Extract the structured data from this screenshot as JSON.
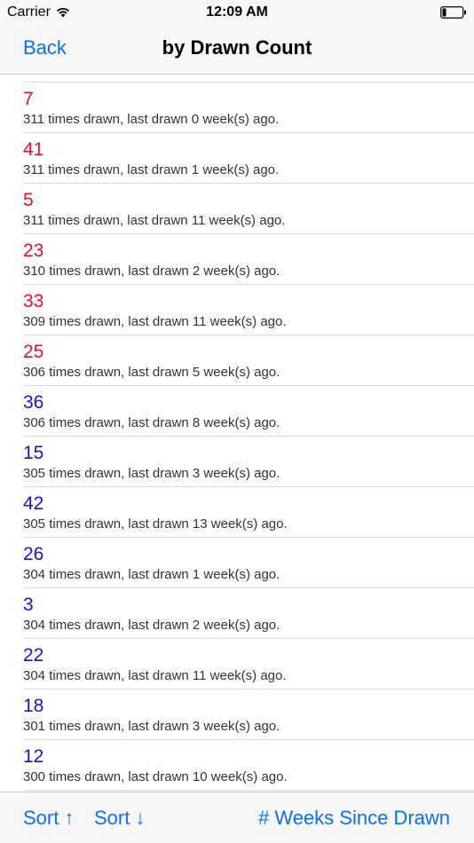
{
  "status_bar": {
    "carrier": "Carrier",
    "time": "12:09 AM"
  },
  "nav": {
    "back_label": "Back",
    "title": "by Drawn Count"
  },
  "colors": {
    "accent": "#0b6ffc",
    "hot": "#e8102a",
    "cold": "#1a12d6"
  },
  "rows": [
    {
      "number": "7",
      "detail": "311 times drawn, last drawn 0 week(s) ago.",
      "group": "hot"
    },
    {
      "number": "41",
      "detail": "311 times drawn, last drawn 1 week(s) ago.",
      "group": "hot"
    },
    {
      "number": "5",
      "detail": "311 times drawn, last drawn 11 week(s) ago.",
      "group": "hot"
    },
    {
      "number": "23",
      "detail": "310 times drawn, last drawn 2 week(s) ago.",
      "group": "hot"
    },
    {
      "number": "33",
      "detail": "309 times drawn, last drawn 11 week(s) ago.",
      "group": "hot"
    },
    {
      "number": "25",
      "detail": "306 times drawn, last drawn 5 week(s) ago.",
      "group": "hot"
    },
    {
      "number": "36",
      "detail": "306 times drawn, last drawn 8 week(s) ago.",
      "group": "cold"
    },
    {
      "number": "15",
      "detail": "305 times drawn, last drawn 3 week(s) ago.",
      "group": "cold"
    },
    {
      "number": "42",
      "detail": "305 times drawn, last drawn 13 week(s) ago.",
      "group": "cold"
    },
    {
      "number": "26",
      "detail": "304 times drawn, last drawn 1 week(s) ago.",
      "group": "cold"
    },
    {
      "number": "3",
      "detail": "304 times drawn, last drawn 2 week(s) ago.",
      "group": "cold"
    },
    {
      "number": "22",
      "detail": "304 times drawn, last drawn 11 week(s) ago.",
      "group": "cold"
    },
    {
      "number": "18",
      "detail": "301 times drawn, last drawn 3 week(s) ago.",
      "group": "cold"
    },
    {
      "number": "12",
      "detail": "300 times drawn, last drawn 10 week(s) ago.",
      "group": "cold"
    }
  ],
  "toolbar": {
    "sort_asc_label": "Sort ↑",
    "sort_desc_label": "Sort ↓",
    "weeks_label": "# Weeks Since Drawn"
  }
}
